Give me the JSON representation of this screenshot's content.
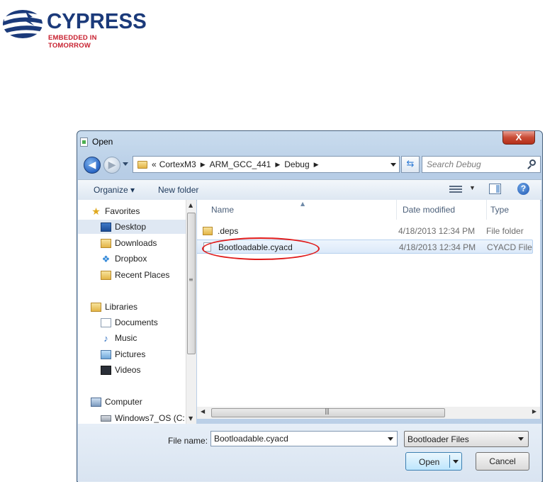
{
  "logo": {
    "name": "CYPRESS",
    "tagline": "EMBEDDED IN TOMORROW"
  },
  "dialog": {
    "title": "Open",
    "close_label": "X",
    "address": {
      "overflow": "«",
      "crumbs": [
        "CortexM3",
        "ARM_GCC_441",
        "Debug"
      ]
    },
    "search_placeholder": "Search Debug",
    "toolbar": {
      "organize": "Organize ▾",
      "new_folder": "New folder"
    },
    "nav": {
      "favorites": "Favorites",
      "desktop": "Desktop",
      "downloads": "Downloads",
      "dropbox": "Dropbox",
      "recent": "Recent Places",
      "libraries": "Libraries",
      "documents": "Documents",
      "music": "Music",
      "pictures": "Pictures",
      "videos": "Videos",
      "computer": "Computer",
      "drive": "Windows7_OS (C:"
    },
    "columns": {
      "name": "Name",
      "date": "Date modified",
      "type": "Type"
    },
    "files": [
      {
        "name": ".deps",
        "date": "4/18/2013 12:34 PM",
        "type": "File folder"
      },
      {
        "name": "Bootloadable.cyacd",
        "date": "4/18/2013 12:34 PM",
        "type": "CYACD File"
      }
    ],
    "file_name_label": "File name:",
    "file_name_value": "Bootloadable.cyacd",
    "file_type": "Bootloader Files",
    "open": "Open",
    "cancel": "Cancel"
  }
}
